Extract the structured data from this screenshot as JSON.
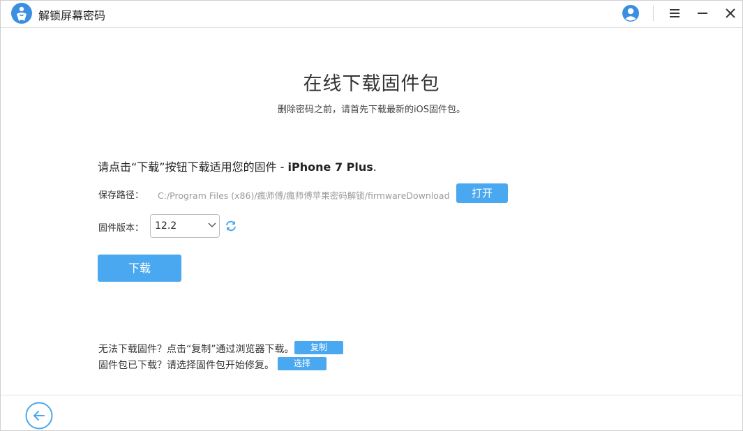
{
  "app": {
    "title": "解锁屏幕密码"
  },
  "page": {
    "title": "在线下载固件包",
    "subtitle": "删除密码之前，请首先下载最新的iOS固件包。"
  },
  "instruction": {
    "prefix": "请点击“下载”按钮下载适用您的固件 - ",
    "device": "iPhone 7 Plus",
    "suffix": "."
  },
  "path": {
    "label": "保存路径：",
    "value": "C:/Program Files (x86)/瘋师傅/瘋师傅苹果密码解锁/firmwareDownload",
    "open_label": "打开"
  },
  "version": {
    "label": "固件版本：",
    "selected": "12.2"
  },
  "download_label": "下载",
  "help": {
    "line1": "无法下载固件？点击“复制”通过浏览器下载。",
    "copy_label": "复制",
    "line2": "固件包已下载？请选择固件包开始修复。",
    "select_label": "选择"
  },
  "colors": {
    "accent": "#4aa8f0",
    "logo": "#3b8fe0"
  },
  "icons": {
    "logo": "person-heart-icon",
    "avatar": "user-avatar-icon",
    "menu": "hamburger-menu-icon",
    "minimize": "minimize-icon",
    "close": "close-icon",
    "refresh": "refresh-icon",
    "back": "arrow-left-icon",
    "chevron": "chevron-down-icon"
  }
}
